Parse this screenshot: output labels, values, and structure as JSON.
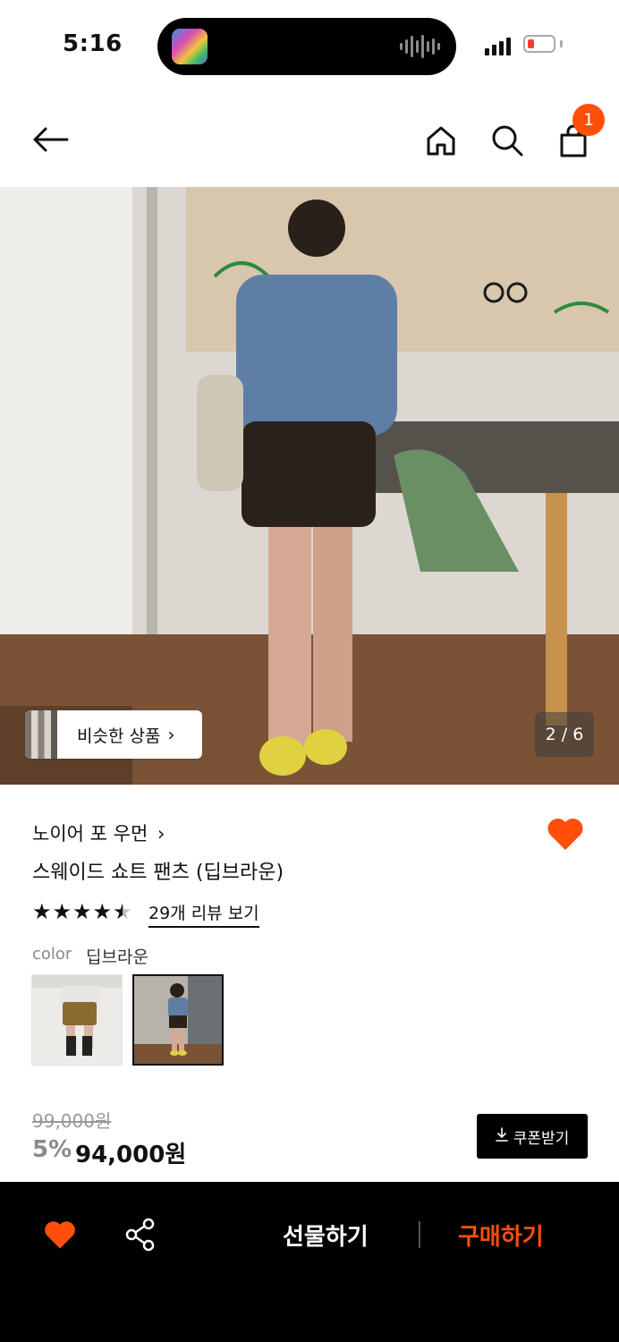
{
  "status_bar": {
    "time": "5:16"
  },
  "nav": {
    "cart_count": "1"
  },
  "hero": {
    "similar_label": "비슷한 상품",
    "page_indicator": "2 / 6"
  },
  "product": {
    "brand": "노이어 포 우먼",
    "title": "스웨이드 쇼트 팬츠 (딥브라운)",
    "rating_stars": 4.5,
    "review_link": "29개 리뷰 보기",
    "color_label": "color",
    "color_value": "딥브라운",
    "original_price": "99,000원",
    "discount": "5%",
    "price": "94,000원",
    "coupon_label": "쿠폰받기"
  },
  "bottom_bar": {
    "gift_label": "선물하기",
    "buy_label": "구매하기"
  },
  "colors": {
    "accent": "#ff4f0b",
    "bar": "#000000"
  }
}
